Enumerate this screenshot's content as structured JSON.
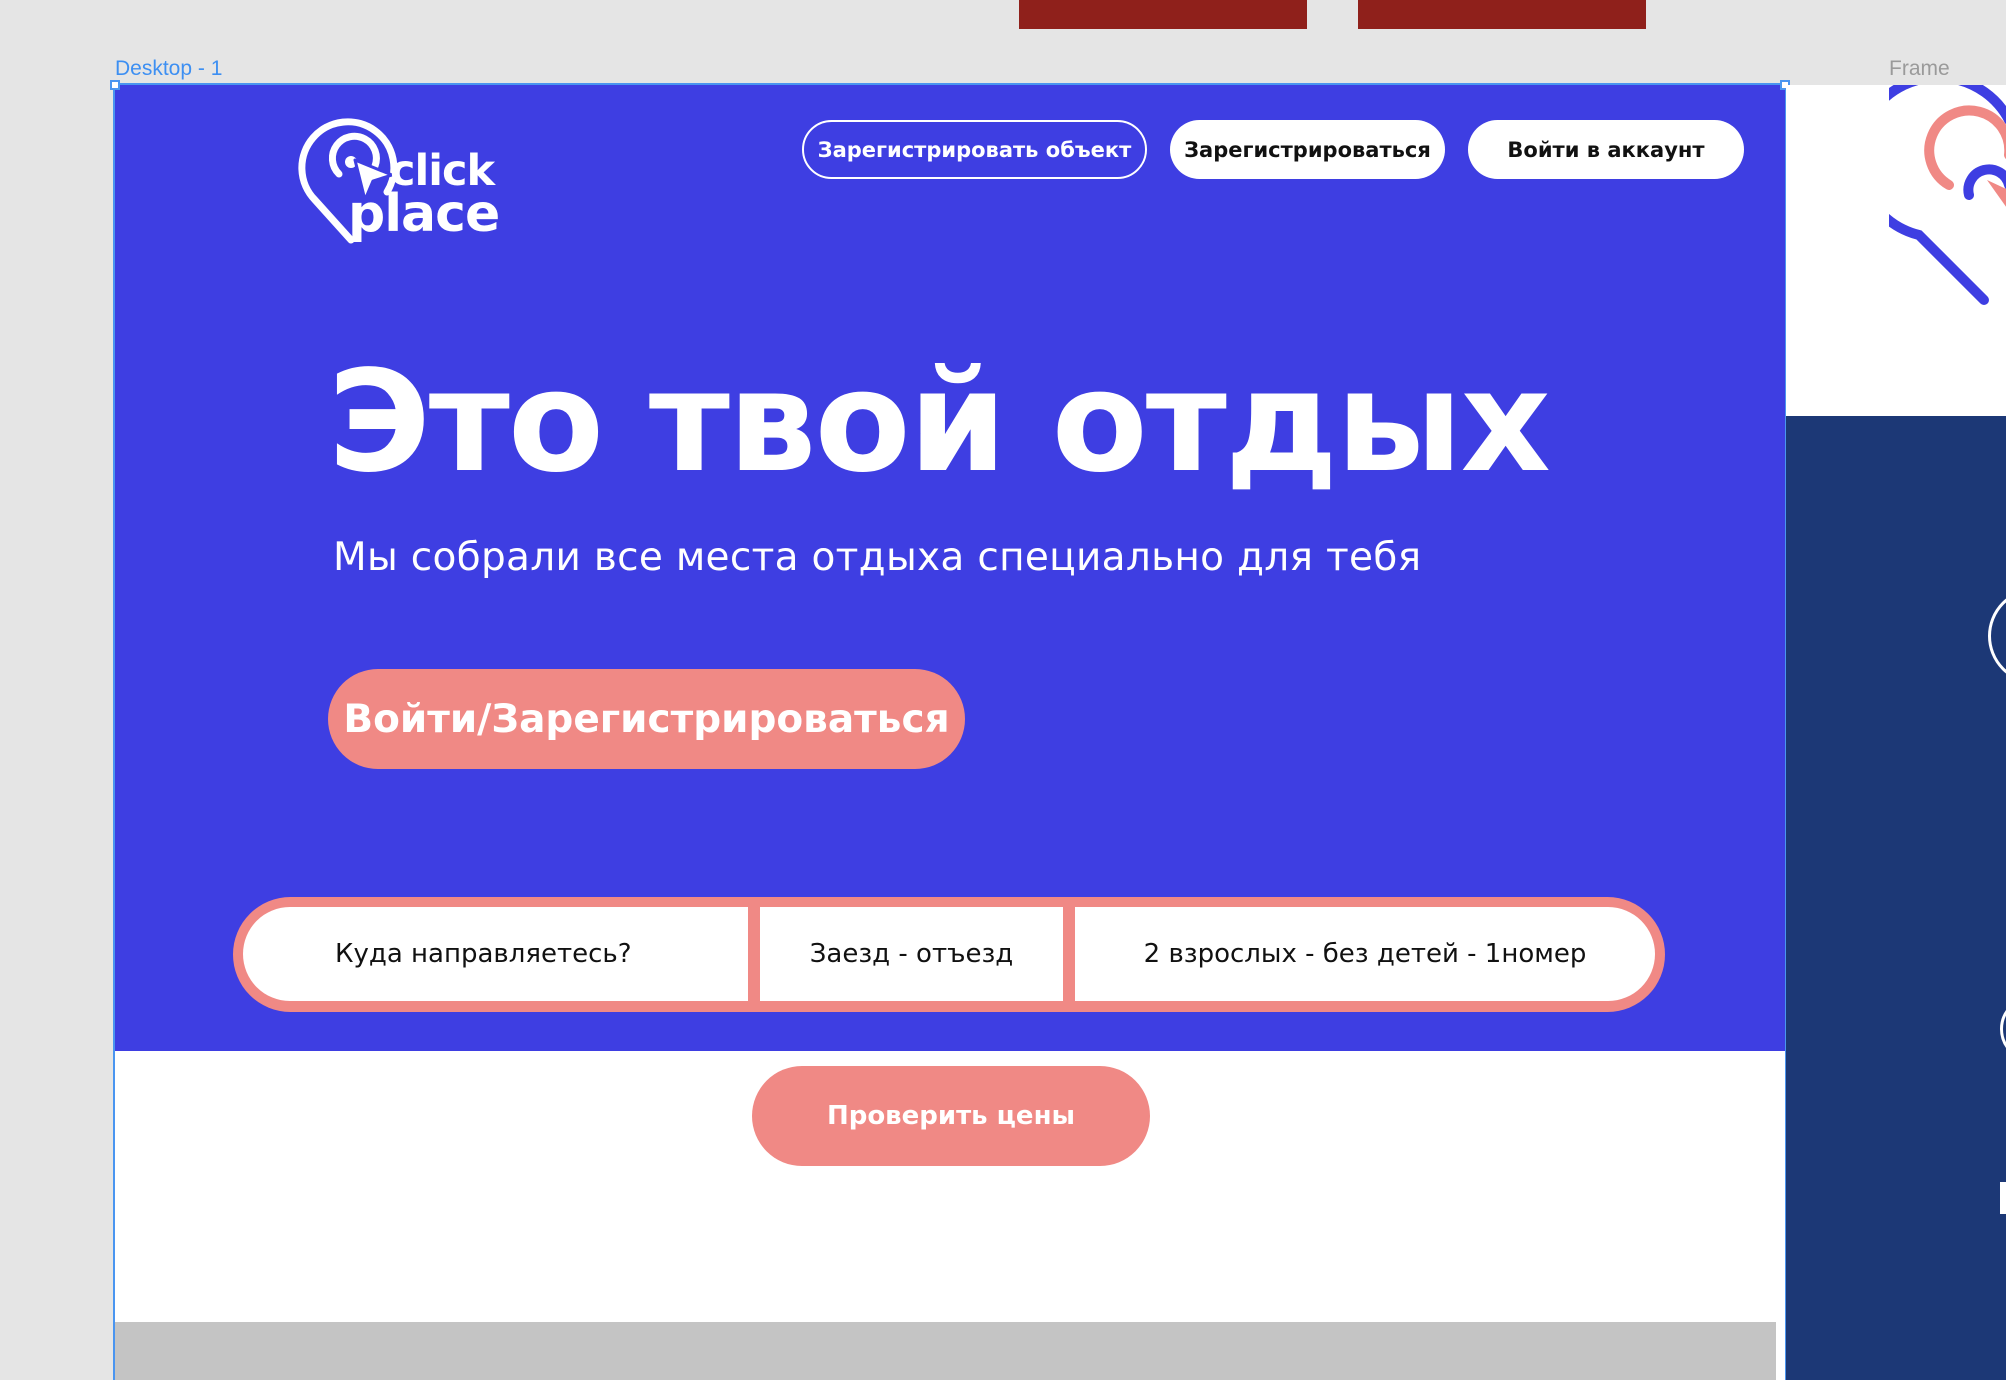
{
  "canvas": {
    "frame_labels": {
      "desktop": "Desktop - 1",
      "right": "Frame"
    }
  },
  "logo": {
    "line1": "click",
    "line2": "place"
  },
  "nav": {
    "register_object": "Зарегистрировать объект",
    "register": "Зарегистрироваться",
    "login": "Войти в аккаунт"
  },
  "hero": {
    "headline": "Это твой отдых",
    "subline": "Мы собрали все места отдыха специально для тебя",
    "cta": "Войти/Зарегистрироваться"
  },
  "search": {
    "destination": "Куда направляетесь?",
    "dates": "Заезд - отъезд",
    "guests": "2 взрослых - без детей - 1номер"
  },
  "check_button": "Проверить цены",
  "colors": {
    "hero_bg": "#3e3ee2",
    "accent": "#f08985",
    "canvas_bg": "#e5e5e5",
    "selection": "#4a95f0",
    "dark_navy": "#1c3876",
    "dark_red": "#8f201b"
  },
  "icons": [
    "click-place-logo-icon",
    "selection-handle"
  ]
}
